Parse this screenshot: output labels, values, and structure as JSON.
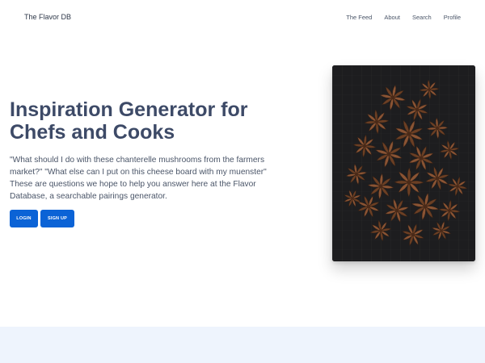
{
  "header": {
    "brand": "The Flavor DB",
    "nav": [
      {
        "label": "The Feed"
      },
      {
        "label": "About"
      },
      {
        "label": "Search"
      },
      {
        "label": "Profile"
      }
    ]
  },
  "hero": {
    "title": "Inspiration Generator for Chefs and Cooks",
    "description": "\"What should I do with these chanterelle mushrooms from the farmers market?\" \"What else can I put on this cheese board with my muenster\" These are questions we hope to help you answer here at the Flavor Database, a searchable pairings generator.",
    "login_label": "LOGIN",
    "signup_label": "SIGN UP",
    "image_icon": "star-anise-photo"
  },
  "colors": {
    "primary": "#0b63d6",
    "title": "#3d4a67",
    "band": "#eef4fd",
    "photo_bg": "#1c1c1e",
    "anise": "#7a4a2c"
  }
}
